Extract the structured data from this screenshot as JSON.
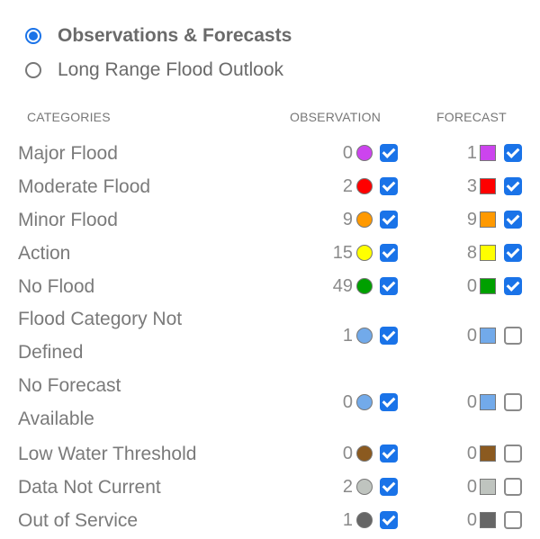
{
  "mode": {
    "options": [
      {
        "label": "Observations & Forecasts",
        "selected": true
      },
      {
        "label": "Long Range Flood Outlook",
        "selected": false
      }
    ]
  },
  "headers": {
    "categories": "CATEGORIES",
    "observation": "OBSERVATION",
    "forecast": "FORECAST"
  },
  "rows": [
    {
      "label": "Major Flood",
      "color": "#cc44ee",
      "obs_count": "0",
      "obs_checked": true,
      "fc_count": "1",
      "fc_checked": true
    },
    {
      "label": "Moderate Flood",
      "color": "#ff0000",
      "obs_count": "2",
      "obs_checked": true,
      "fc_count": "3",
      "fc_checked": true
    },
    {
      "label": "Minor Flood",
      "color": "#ff9900",
      "obs_count": "9",
      "obs_checked": true,
      "fc_count": "9",
      "fc_checked": true
    },
    {
      "label": "Action",
      "color": "#ffff00",
      "obs_count": "15",
      "obs_checked": true,
      "fc_count": "8",
      "fc_checked": true
    },
    {
      "label": "No Flood",
      "color": "#00a000",
      "obs_count": "49",
      "obs_checked": true,
      "fc_count": "0",
      "fc_checked": true
    },
    {
      "label_line1": "Flood Category Not",
      "label_line2": "Defined",
      "color": "#72aaea",
      "obs_count": "1",
      "obs_checked": true,
      "fc_count": "0",
      "fc_checked": false
    },
    {
      "label_line1": "No Forecast",
      "label_line2": "Available",
      "color": "#72aaea",
      "obs_count": "0",
      "obs_checked": true,
      "fc_count": "0",
      "fc_checked": false
    },
    {
      "label": "Low Water Threshold",
      "color": "#8b5a20",
      "obs_count": "0",
      "obs_checked": true,
      "fc_count": "0",
      "fc_checked": false
    },
    {
      "label": "Data Not Current",
      "color": "#bfc4bf",
      "obs_count": "2",
      "obs_checked": true,
      "fc_count": "0",
      "fc_checked": false
    },
    {
      "label": "Out of Service",
      "color": "#666666",
      "obs_count": "1",
      "obs_checked": true,
      "fc_count": "0",
      "fc_checked": false
    }
  ]
}
